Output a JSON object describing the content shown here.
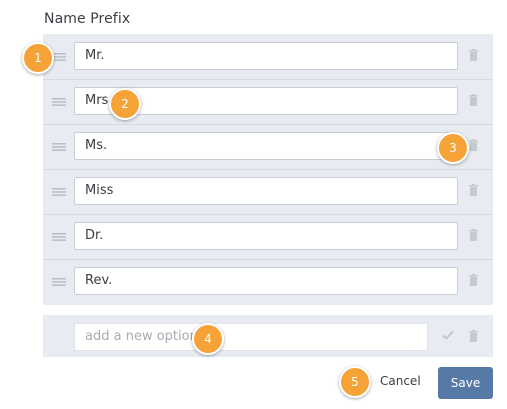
{
  "title": "Name Prefix",
  "options": [
    {
      "value": "Mr."
    },
    {
      "value": "Mrs."
    },
    {
      "value": "Ms."
    },
    {
      "value": "Miss"
    },
    {
      "value": "Dr."
    },
    {
      "value": "Rev."
    }
  ],
  "new_option": {
    "placeholder": "add a new option"
  },
  "actions": {
    "cancel": "Cancel",
    "save": "Save"
  },
  "callouts": [
    "1",
    "2",
    "3",
    "4",
    "5"
  ],
  "colors": {
    "accent": "#5779a6",
    "callout": "#f5a236",
    "panel": "#e8ebf1"
  }
}
